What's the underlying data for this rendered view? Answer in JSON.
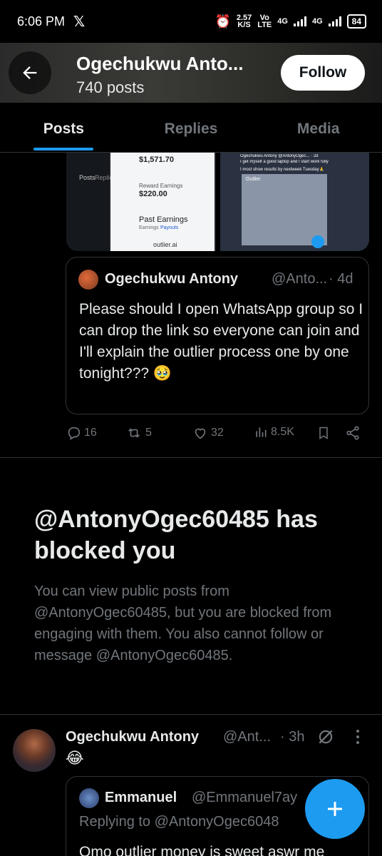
{
  "status_bar": {
    "time": "6:06 PM",
    "x_logo": "𝕏",
    "speed_value": "2.57",
    "speed_unit": "K/S",
    "vo": "Vo",
    "lte": "LTE",
    "net1": "4G",
    "net2": "4G",
    "battery": "84"
  },
  "header": {
    "title": "Ogechukwu Anto...",
    "post_count": "740 posts",
    "follow_label": "Follow"
  },
  "tabs": [
    {
      "label": "Posts",
      "active": true
    },
    {
      "label": "Replies",
      "active": false
    },
    {
      "label": "Media",
      "active": false
    }
  ],
  "media": {
    "thumb1": {
      "amount": "$1,571.70",
      "reward_label": "Reward Earnings",
      "reward_value": "$220.00",
      "past_label": "Past Earnings",
      "tab_a": "Earnings",
      "tab_b": "Payouts",
      "url": "outlier.ai",
      "side_a": "Posts",
      "side_b": "Replies"
    },
    "thumb2": {
      "header": "Ogechukwu Antony @AntonyOgec... · 2d",
      "line1": "I get myself a good laptop and I start work fully",
      "line2": "I most show results by nextweek Tuesday🙏",
      "app": "Outlier"
    }
  },
  "post1": {
    "quote": {
      "name": "Ogechukwu Antony",
      "handle": "@Anto...",
      "time": "· 4d",
      "text": "Please should I open WhatsApp group so I can drop the link so everyone can join and I'll explain the outlier process one by one tonight??? 🥹"
    },
    "actions": {
      "replies": "16",
      "reposts": "5",
      "likes": "32",
      "views": "8.5K"
    }
  },
  "blocked": {
    "title": "@AntonyOgec60485 has blocked you",
    "body": "You can view public posts from @AntonyOgec60485, but you are blocked from engaging with them. You also cannot follow or message @AntonyOgec60485."
  },
  "post2": {
    "name": "Ogechukwu Antony",
    "handle": "@Ant...",
    "time": "· 3h",
    "text": "😂",
    "quote": {
      "name": "Emmanuel",
      "handle": "@Emmanuel7ay",
      "replying": "Replying to @AntonyOgec6048",
      "text": "Omo outlier money is sweet aswr me"
    }
  },
  "colors": {
    "accent": "#1d9bf0",
    "muted": "#71767b",
    "border": "#2f3336",
    "background": "#000000"
  }
}
